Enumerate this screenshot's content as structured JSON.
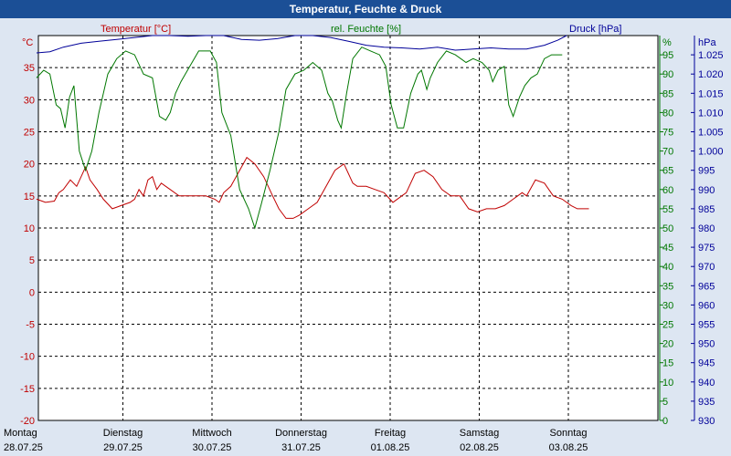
{
  "title": "Temperatur, Feuchte & Druck",
  "chart_data": {
    "type": "line",
    "x_days": [
      {
        "day": "Montag",
        "date": "28.07.25"
      },
      {
        "day": "Dienstag",
        "date": "29.07.25"
      },
      {
        "day": "Mittwoch",
        "date": "30.07.25"
      },
      {
        "day": "Donnerstag",
        "date": "31.07.25"
      },
      {
        "day": "Freitag",
        "date": "01.08.25"
      },
      {
        "day": "Samstag",
        "date": "02.08.25"
      },
      {
        "day": "Sonntag",
        "date": "03.08.25"
      }
    ],
    "axes": {
      "temperature": {
        "label": "Temperatur [°C]",
        "unit": "°C",
        "range": [
          -20,
          40
        ],
        "ticks": [
          -20,
          -15,
          -10,
          -5,
          0,
          5,
          10,
          15,
          20,
          25,
          30,
          35
        ]
      },
      "humidity": {
        "label": "rel. Feuchte [%]",
        "unit": "%",
        "range": [
          0,
          100
        ],
        "ticks": [
          0,
          5,
          10,
          15,
          20,
          25,
          30,
          35,
          40,
          45,
          50,
          55,
          60,
          65,
          70,
          75,
          80,
          85,
          90,
          95
        ]
      },
      "pressure": {
        "label": "Druck [hPa]",
        "unit": "hPa",
        "range": [
          930,
          1030
        ],
        "ticks": [
          "930",
          "935",
          "940",
          "945",
          "950",
          "955",
          "960",
          "965",
          "970",
          "975",
          "980",
          "985",
          "990",
          "995",
          "1.000",
          "1.005",
          "1.010",
          "1.015",
          "1.020",
          "1.025"
        ]
      }
    },
    "grid": true,
    "colors": {
      "temperature": "#c00000",
      "humidity": "#007700",
      "pressure": "#000099",
      "grid": "#000000",
      "plot_bg": "#ffffff"
    },
    "series": [
      {
        "name": "Temperatur [°C]",
        "axis": "temperature",
        "points": [
          [
            0,
            14.5
          ],
          [
            0.1,
            14
          ],
          [
            0.2,
            14.2
          ],
          [
            0.25,
            15.5
          ],
          [
            0.3,
            16
          ],
          [
            0.38,
            17.5
          ],
          [
            0.45,
            16.5
          ],
          [
            0.5,
            18
          ],
          [
            0.55,
            19.5
          ],
          [
            0.6,
            17.5
          ],
          [
            0.68,
            16
          ],
          [
            0.75,
            14.5
          ],
          [
            0.85,
            13
          ],
          [
            0.95,
            13.5
          ],
          [
            1.05,
            14
          ],
          [
            1.1,
            14.5
          ],
          [
            1.15,
            16
          ],
          [
            1.2,
            15
          ],
          [
            1.25,
            17.5
          ],
          [
            1.3,
            18
          ],
          [
            1.35,
            16
          ],
          [
            1.4,
            17
          ],
          [
            1.5,
            16
          ],
          [
            1.6,
            15
          ],
          [
            1.7,
            15
          ],
          [
            1.8,
            15
          ],
          [
            1.9,
            15
          ],
          [
            2.0,
            14.5
          ],
          [
            2.05,
            14
          ],
          [
            2.1,
            15.5
          ],
          [
            2.18,
            16.5
          ],
          [
            2.28,
            19
          ],
          [
            2.36,
            21
          ],
          [
            2.45,
            20
          ],
          [
            2.55,
            18
          ],
          [
            2.65,
            15
          ],
          [
            2.72,
            13
          ],
          [
            2.8,
            11.5
          ],
          [
            2.88,
            11.5
          ],
          [
            2.95,
            12
          ],
          [
            3.05,
            13
          ],
          [
            3.15,
            14
          ],
          [
            3.25,
            16.5
          ],
          [
            3.35,
            19
          ],
          [
            3.45,
            20
          ],
          [
            3.55,
            17
          ],
          [
            3.6,
            16.5
          ],
          [
            3.7,
            16.5
          ],
          [
            3.8,
            16
          ],
          [
            3.9,
            15.5
          ],
          [
            4.0,
            14
          ],
          [
            4.1,
            15
          ],
          [
            4.15,
            15.5
          ],
          [
            4.25,
            18.5
          ],
          [
            4.35,
            19
          ],
          [
            4.45,
            18
          ],
          [
            4.55,
            16
          ],
          [
            4.65,
            15
          ],
          [
            4.75,
            15
          ],
          [
            4.85,
            13
          ],
          [
            4.95,
            12.5
          ],
          [
            5.05,
            13
          ],
          [
            5.15,
            13
          ],
          [
            5.25,
            13.5
          ],
          [
            5.35,
            14.5
          ],
          [
            5.45,
            15.5
          ],
          [
            5.5,
            15
          ],
          [
            5.6,
            17.5
          ],
          [
            5.7,
            17
          ],
          [
            5.8,
            15
          ],
          [
            5.9,
            14.5
          ],
          [
            6.0,
            13.5
          ],
          [
            6.07,
            13
          ],
          [
            6.12,
            13
          ],
          [
            6.2,
            13
          ]
        ]
      },
      {
        "name": "rel. Feuchte [%]",
        "axis": "humidity",
        "points": [
          [
            0,
            89
          ],
          [
            0.08,
            91
          ],
          [
            0.15,
            90
          ],
          [
            0.22,
            82
          ],
          [
            0.27,
            81
          ],
          [
            0.32,
            76
          ],
          [
            0.37,
            84
          ],
          [
            0.42,
            87
          ],
          [
            0.48,
            70
          ],
          [
            0.55,
            65
          ],
          [
            0.62,
            70
          ],
          [
            0.7,
            80
          ],
          [
            0.8,
            90
          ],
          [
            0.9,
            94
          ],
          [
            1.0,
            96
          ],
          [
            1.1,
            95
          ],
          [
            1.2,
            90
          ],
          [
            1.3,
            89
          ],
          [
            1.38,
            79
          ],
          [
            1.45,
            78
          ],
          [
            1.5,
            80
          ],
          [
            1.56,
            85
          ],
          [
            1.62,
            88
          ],
          [
            1.72,
            92
          ],
          [
            1.82,
            96
          ],
          [
            1.95,
            96
          ],
          [
            2.02,
            93
          ],
          [
            2.08,
            80
          ],
          [
            2.18,
            74
          ],
          [
            2.28,
            60
          ],
          [
            2.38,
            55
          ],
          [
            2.45,
            50
          ],
          [
            2.52,
            56
          ],
          [
            2.62,
            65
          ],
          [
            2.72,
            75
          ],
          [
            2.8,
            86
          ],
          [
            2.9,
            90
          ],
          [
            3.0,
            91
          ],
          [
            3.1,
            93
          ],
          [
            3.2,
            91
          ],
          [
            3.27,
            85
          ],
          [
            3.32,
            83
          ],
          [
            3.38,
            78
          ],
          [
            3.42,
            76
          ],
          [
            3.48,
            85
          ],
          [
            3.55,
            94
          ],
          [
            3.65,
            97
          ],
          [
            3.75,
            96
          ],
          [
            3.85,
            95
          ],
          [
            3.92,
            92
          ],
          [
            3.98,
            82
          ],
          [
            4.05,
            76
          ],
          [
            4.12,
            76
          ],
          [
            4.2,
            85
          ],
          [
            4.28,
            90
          ],
          [
            4.32,
            91
          ],
          [
            4.38,
            86
          ],
          [
            4.42,
            89
          ],
          [
            4.5,
            93
          ],
          [
            4.6,
            96
          ],
          [
            4.7,
            95
          ],
          [
            4.82,
            93
          ],
          [
            4.9,
            94
          ],
          [
            5.0,
            93
          ],
          [
            5.08,
            91
          ],
          [
            5.12,
            88
          ],
          [
            5.18,
            91
          ],
          [
            5.25,
            92
          ],
          [
            5.3,
            82
          ],
          [
            5.35,
            79
          ],
          [
            5.42,
            84
          ],
          [
            5.48,
            87
          ],
          [
            5.55,
            89
          ],
          [
            5.62,
            90
          ],
          [
            5.7,
            94
          ],
          [
            5.78,
            95
          ],
          [
            5.8,
            95
          ],
          [
            5.9,
            95
          ]
        ]
      },
      {
        "name": "Druck [hPa]",
        "axis": "pressure",
        "points": [
          [
            0,
            1025.5
          ],
          [
            0.15,
            1025.8
          ],
          [
            0.3,
            1027
          ],
          [
            0.5,
            1028
          ],
          [
            0.7,
            1028.5
          ],
          [
            0.9,
            1029
          ],
          [
            1.1,
            1029.5
          ],
          [
            1.3,
            1030
          ],
          [
            1.5,
            1030
          ],
          [
            1.7,
            1029.8
          ],
          [
            1.9,
            1030
          ],
          [
            2.1,
            1030
          ],
          [
            2.3,
            1029
          ],
          [
            2.5,
            1028.8
          ],
          [
            2.7,
            1029.2
          ],
          [
            2.9,
            1030
          ],
          [
            3.1,
            1030.5
          ],
          [
            3.3,
            1029.5
          ],
          [
            3.5,
            1028.5
          ],
          [
            3.7,
            1027.5
          ],
          [
            3.9,
            1027
          ],
          [
            4.1,
            1026.8
          ],
          [
            4.3,
            1026.5
          ],
          [
            4.5,
            1027
          ],
          [
            4.7,
            1026.2
          ],
          [
            4.9,
            1026.5
          ],
          [
            5.1,
            1026.8
          ],
          [
            5.3,
            1026.5
          ],
          [
            5.5,
            1026.5
          ],
          [
            5.7,
            1027.5
          ],
          [
            5.85,
            1028.8
          ],
          [
            5.95,
            1030.2
          ]
        ]
      }
    ]
  }
}
